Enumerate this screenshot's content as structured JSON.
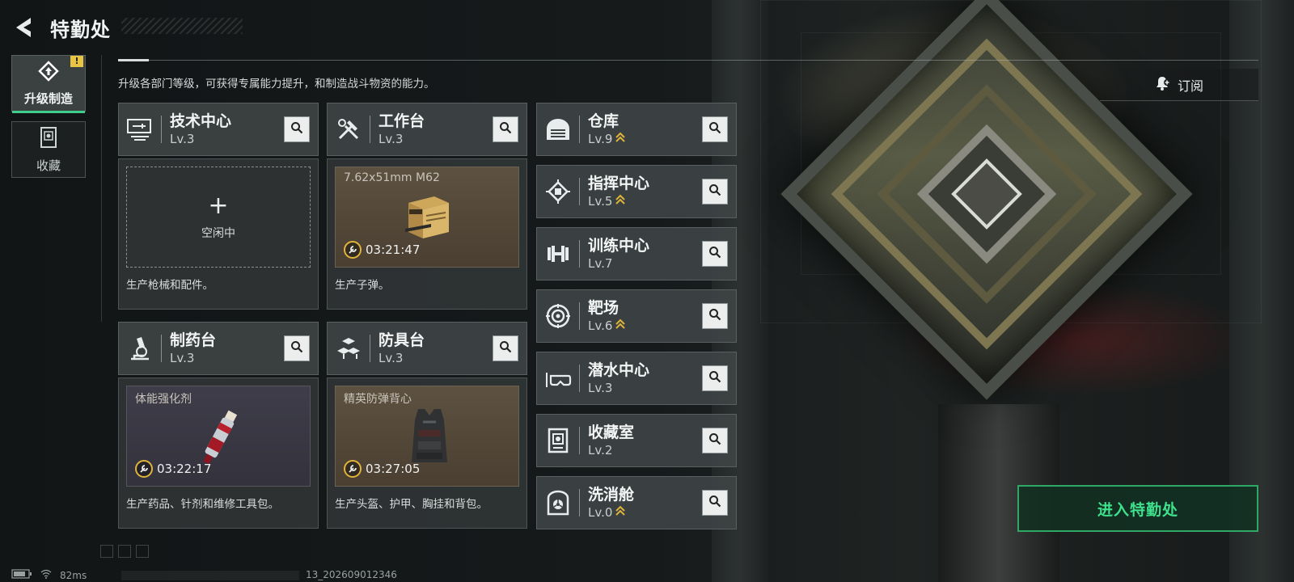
{
  "header": {
    "title": "特勤处"
  },
  "sidebar": {
    "items": [
      {
        "label": "升级制造",
        "icon": "upgrade-craft-icon",
        "badge": "!"
      },
      {
        "label": "收藏",
        "icon": "collection-icon"
      }
    ]
  },
  "description": "升级各部门等级，可获得专属能力提升，和制造战斗物资的能力。",
  "subscribe": {
    "label": "订阅",
    "icon": "bell-plus-icon"
  },
  "cards": [
    {
      "name": "技术中心",
      "level": "Lv.3",
      "icon": "tech-center-icon",
      "slot": {
        "state": "empty",
        "idle_label": "空闲中"
      },
      "desc": "生产枪械和配件。"
    },
    {
      "name": "工作台",
      "level": "Lv.3",
      "icon": "workbench-tools-icon",
      "slot": {
        "state": "producing",
        "item": "7.62x51mm M62",
        "timer": "03:21:47"
      },
      "desc": "生产子弹。"
    },
    {
      "name": "制药台",
      "level": "Lv.3",
      "icon": "microscope-icon",
      "slot": {
        "state": "producing",
        "item": "体能强化剂",
        "timer": "03:22:17"
      },
      "desc": "生产药品、针剂和维修工具包。"
    },
    {
      "name": "防具台",
      "level": "Lv.3",
      "icon": "armor-blocks-icon",
      "slot": {
        "state": "producing",
        "item": "精英防弹背心",
        "timer": "03:27:05"
      },
      "desc": "生产头盔、护甲、胸挂和背包。"
    }
  ],
  "departments": [
    {
      "name": "仓库",
      "level": "Lv.9",
      "upgradable": true,
      "icon": "warehouse-icon"
    },
    {
      "name": "指挥中心",
      "level": "Lv.5",
      "upgradable": true,
      "icon": "command-chip-icon"
    },
    {
      "name": "训练中心",
      "level": "Lv.7",
      "upgradable": false,
      "icon": "dumbbell-icon"
    },
    {
      "name": "靶场",
      "level": "Lv.6",
      "upgradable": true,
      "icon": "target-icon"
    },
    {
      "name": "潜水中心",
      "level": "Lv.3",
      "upgradable": false,
      "icon": "dive-mask-icon"
    },
    {
      "name": "收藏室",
      "level": "Lv.2",
      "upgradable": false,
      "icon": "collection-room-icon"
    },
    {
      "name": "洗消舱",
      "level": "Lv.0",
      "upgradable": true,
      "icon": "decon-biohazard-icon"
    }
  ],
  "enter_button": {
    "label": "进入特勤处"
  },
  "status": {
    "ping": "82ms",
    "build": "13_202609012346"
  },
  "colors": {
    "accent_green": "#3fe08c",
    "upgrade_gold": "#e0b43a"
  }
}
